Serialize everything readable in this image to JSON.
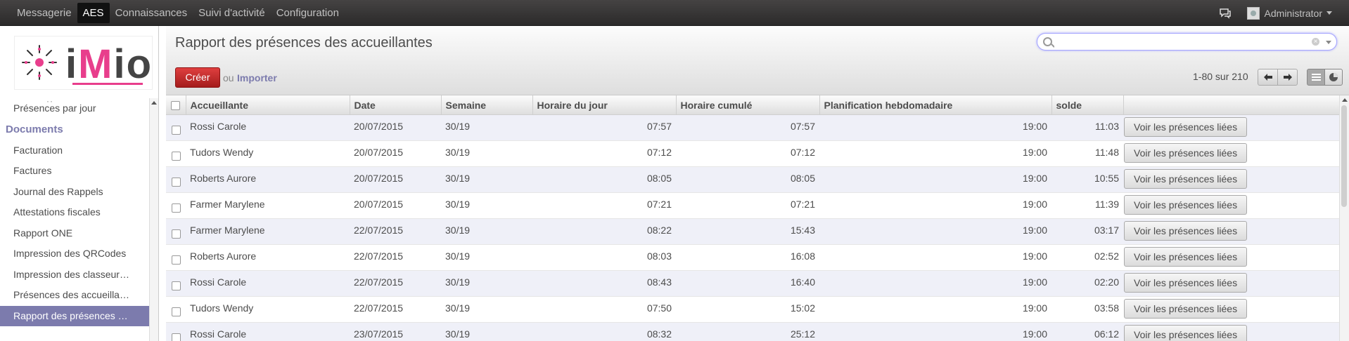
{
  "topbar": {
    "menu": [
      "Messagerie",
      "AES",
      "Connaissances",
      "Suivi d'activité",
      "Configuration"
    ],
    "active": "AES",
    "user": "Administrator"
  },
  "sidebar": {
    "items": [
      {
        "label": "Présences par jour",
        "type": "item"
      },
      {
        "label": "Documents",
        "type": "section"
      },
      {
        "label": "Facturation",
        "type": "item"
      },
      {
        "label": "Factures",
        "type": "item"
      },
      {
        "label": "Journal des Rappels",
        "type": "item"
      },
      {
        "label": "Attestations fiscales",
        "type": "item"
      },
      {
        "label": "Rapport ONE",
        "type": "item"
      },
      {
        "label": "Impression des QRCodes",
        "type": "item"
      },
      {
        "label": "Impression des classeur…",
        "type": "item"
      },
      {
        "label": "Présences des accueilla…",
        "type": "item"
      },
      {
        "label": "Rapport des présences …",
        "type": "item",
        "selected": true
      }
    ]
  },
  "header": {
    "title": "Rapport des présences des accueillantes",
    "create_label": "Créer",
    "or_label": "ou",
    "import_label": "Importer",
    "pager": "1-80 sur 210",
    "search_value": ""
  },
  "table": {
    "columns": [
      "Accueillante",
      "Date",
      "Semaine",
      "Horaire du jour",
      "Horaire cumulé",
      "Planification hebdomadaire",
      "solde"
    ],
    "row_button": "Voir les présences liées",
    "rows": [
      [
        "Rossi Carole",
        "20/07/2015",
        "30/19",
        "07:57",
        "07:57",
        "19:00",
        "11:03"
      ],
      [
        "Tudors Wendy",
        "20/07/2015",
        "30/19",
        "07:12",
        "07:12",
        "19:00",
        "11:48"
      ],
      [
        "Roberts Aurore",
        "20/07/2015",
        "30/19",
        "08:05",
        "08:05",
        "19:00",
        "10:55"
      ],
      [
        "Farmer Marylene",
        "20/07/2015",
        "30/19",
        "07:21",
        "07:21",
        "19:00",
        "11:39"
      ],
      [
        "Farmer Marylene",
        "22/07/2015",
        "30/19",
        "08:22",
        "15:43",
        "19:00",
        "03:17"
      ],
      [
        "Roberts Aurore",
        "22/07/2015",
        "30/19",
        "08:03",
        "16:08",
        "19:00",
        "02:52"
      ],
      [
        "Rossi Carole",
        "22/07/2015",
        "30/19",
        "08:43",
        "16:40",
        "19:00",
        "02:20"
      ],
      [
        "Tudors Wendy",
        "22/07/2015",
        "30/19",
        "07:50",
        "15:02",
        "19:00",
        "03:58"
      ],
      [
        "Rossi Carole",
        "23/07/2015",
        "30/19",
        "08:32",
        "25:12",
        "19:00",
        "06:12"
      ]
    ]
  },
  "colors": {
    "accent": "#7c7bad",
    "create": "#c02a2a",
    "topbar": "#333333"
  }
}
